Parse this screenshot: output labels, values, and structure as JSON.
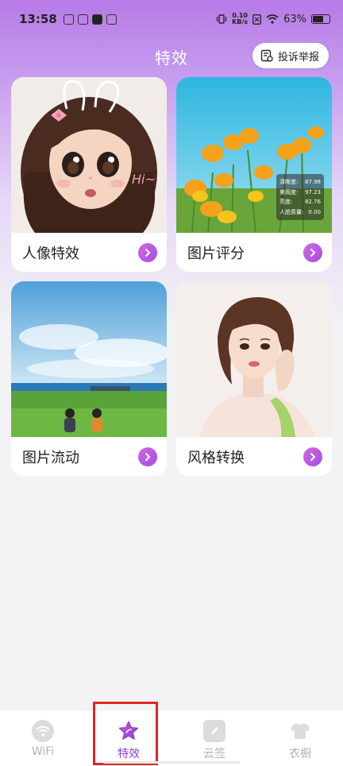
{
  "status_bar": {
    "time": "13:58",
    "net_speed_value": "0.10",
    "net_speed_unit": "KB/s",
    "battery": "63%"
  },
  "header": {
    "title": "特效",
    "report_button": "投诉举报"
  },
  "cards": [
    {
      "label": "人像特效",
      "image": "cartoon-girl-portrait"
    },
    {
      "label": "图片评分",
      "image": "orange-poppy-flowers"
    },
    {
      "label": "图片流动",
      "image": "grass-field-sky"
    },
    {
      "label": "风格转换",
      "image": "illustrated-woman-portrait"
    }
  ],
  "score_overlay": {
    "rows": [
      {
        "label": "清晰度:",
        "value": "87.98"
      },
      {
        "label": "美观度:",
        "value": "97.23"
      },
      {
        "label": "亮度:",
        "value": "82.76"
      },
      {
        "label": "人脸质量:",
        "value": "0.00"
      }
    ],
    "hi_text": "Hi~"
  },
  "tabs": [
    {
      "label": "WiFi",
      "icon": "wifi-icon",
      "active": false
    },
    {
      "label": "特效",
      "icon": "star-icon",
      "active": true
    },
    {
      "label": "云签",
      "icon": "pen-icon",
      "active": false
    },
    {
      "label": "衣橱",
      "icon": "tshirt-icon",
      "active": false
    }
  ],
  "colors": {
    "accent": "#8a3fd6",
    "highlight": "#e02424"
  }
}
